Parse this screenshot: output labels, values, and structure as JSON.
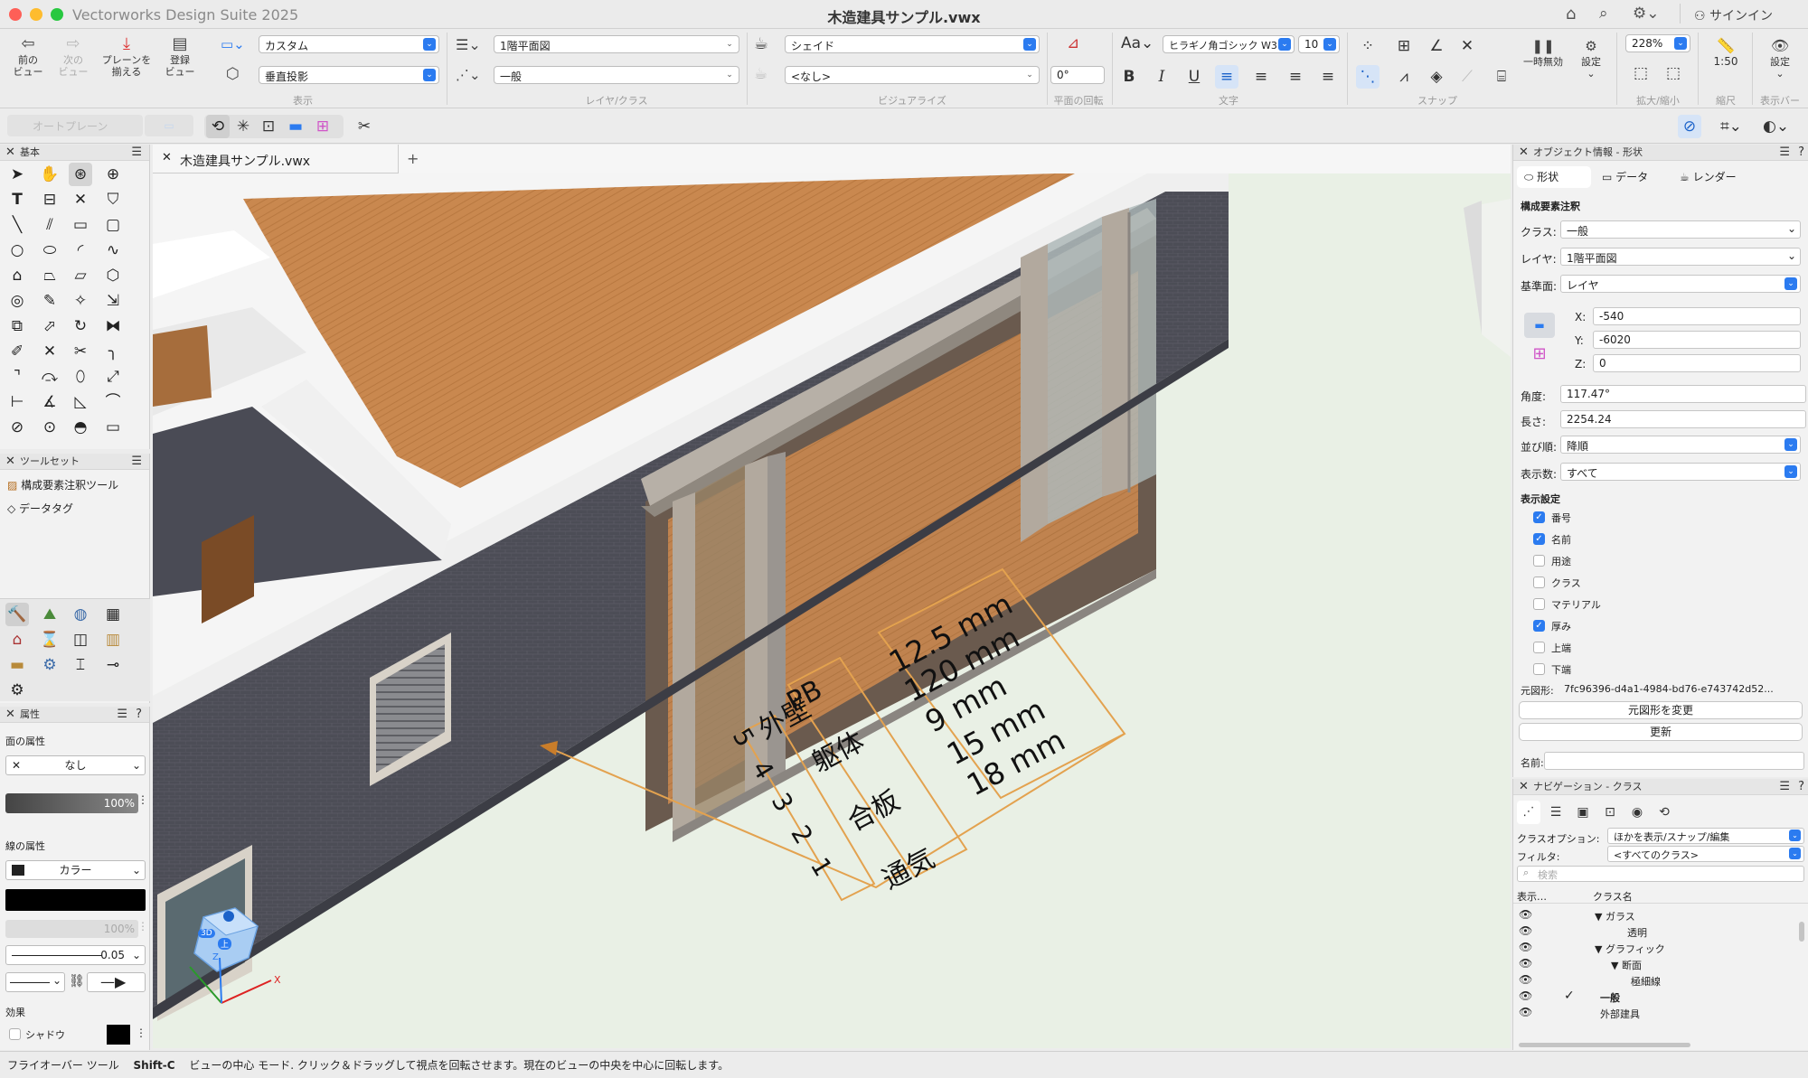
{
  "window": {
    "app_title": "Vectorworks Design Suite 2025",
    "doc_title": "木造建具サンプル.vwx",
    "signin": "サインイン"
  },
  "toolbar": {
    "prev_view": "前の\nビュー",
    "next_view": "次の\nビュー",
    "align_plane": "プレーンを\n揃える",
    "saved_view": "登録\nビュー",
    "view_select": "カスタム",
    "projection_select": "垂直投影",
    "group_display": "表示",
    "layer_select": "1階平面図",
    "class_select": "一般",
    "group_layer_class": "レイヤ/クラス",
    "render_select": "シェイド",
    "lighting_select": "<なし>",
    "group_visualize": "ビジュアライズ",
    "rotation_value": "0°",
    "group_plane_rotation": "平面の回転",
    "font_select": "ヒラギノ角ゴシック W3",
    "font_size_select": "10",
    "group_text": "文字",
    "group_snap": "スナップ",
    "pause_label": "一時無効",
    "settings_label": "設定",
    "zoom_value": "228%",
    "group_zoom": "拡大/縮小",
    "scale_value": "1:50",
    "group_scale": "縮尺",
    "display_settings_label": "設定",
    "group_display_bar": "表示バー"
  },
  "toolbar2": {
    "auto_plane": "オートプレーン"
  },
  "palettes": {
    "basic_title": "基本",
    "toolsets_title": "ツールセット",
    "toolset_items": [
      "構成要素注釈ツール",
      "データタグ"
    ],
    "attributes_title": "属性",
    "fill_attr_label": "面の属性",
    "fill_value": "なし",
    "opacity_value": "100%",
    "line_attr_label": "線の属性",
    "line_color_value": "カラー",
    "line_opacity_value": "100%",
    "line_weight_value": "0.05",
    "effects_label": "効果",
    "shadow_label": "シャドウ"
  },
  "canvas": {
    "doc_tab": "木造建具サンプル.vwx",
    "annotation_numbers": [
      "5",
      "4",
      "3",
      "2",
      "1"
    ],
    "annotation_names": [
      "PB",
      "躯体",
      "合板",
      "通気",
      "外壁"
    ],
    "annotation_thickness": [
      "12.5 mm",
      "120 mm",
      "9 mm",
      "15 mm",
      "18 mm"
    ],
    "cube_label_3d": "3D",
    "cube_label_top": "上",
    "axis_x": "X",
    "axis_z": "Z"
  },
  "oip": {
    "title": "オブジェクト情報 - 形状",
    "tabs": [
      "形状",
      "データ",
      "レンダー"
    ],
    "object_type": "構成要素注釈",
    "class_label": "クラス:",
    "class_value": "一般",
    "layer_label": "レイヤ:",
    "layer_value": "1階平面図",
    "plane_label": "基準面:",
    "plane_value": "レイヤ",
    "x_label": "X:",
    "x_value": "-540",
    "y_label": "Y:",
    "y_value": "-6020",
    "z_label": "Z:",
    "z_value": "0",
    "angle_label": "角度:",
    "angle_value": "117.47°",
    "length_label": "長さ:",
    "length_value": "2254.24",
    "order_label": "並び順:",
    "order_value": "降順",
    "count_label": "表示数:",
    "count_value": "すべて",
    "display_settings": "表示設定",
    "checks": [
      {
        "label": "番号",
        "checked": true
      },
      {
        "label": "名前",
        "checked": true
      },
      {
        "label": "用途",
        "checked": false
      },
      {
        "label": "クラス",
        "checked": false
      },
      {
        "label": "マテリアル",
        "checked": false
      },
      {
        "label": "厚み",
        "checked": true
      },
      {
        "label": "上端",
        "checked": false
      },
      {
        "label": "下端",
        "checked": false
      }
    ],
    "source_label": "元図形:",
    "source_value": "7fc96396-d4a1-4984-bd76-e743742d52...",
    "change_source_button": "元図形を変更",
    "update_button": "更新",
    "name_label": "名前:"
  },
  "nav": {
    "title": "ナビゲーション - クラス",
    "class_options_label": "クラスオプション:",
    "class_options_value": "ほかを表示/スナップ/編集",
    "filter_label": "フィルタ:",
    "filter_value": "<すべてのクラス>",
    "search_placeholder": "検索",
    "col_visibility": "表示…",
    "col_class_name": "クラス名",
    "rows": [
      {
        "name": "▼ ガラス",
        "indent": 0
      },
      {
        "name": "透明",
        "indent": 2
      },
      {
        "name": "▼ グラフィック",
        "indent": 0
      },
      {
        "name": "▼ 断面",
        "indent": 1
      },
      {
        "name": "極細線",
        "indent": 2
      },
      {
        "name": "一般",
        "indent": 0
      },
      {
        "name": "外部建具",
        "indent": 0
      }
    ]
  },
  "status": {
    "tool_name": "フライオーバー ツール",
    "shortcut": "Shift-C",
    "hint": "ビューの中心 モード. クリック＆ドラッグして視点を回転させます。現在のビューの中央を中心に回転します。"
  },
  "colors": {
    "accent": "#2b7bf0",
    "annotation": "#e3a24f",
    "wall": "#4b4c55",
    "floor_wood": "#c8854d",
    "ground": "#e9f0e5"
  }
}
